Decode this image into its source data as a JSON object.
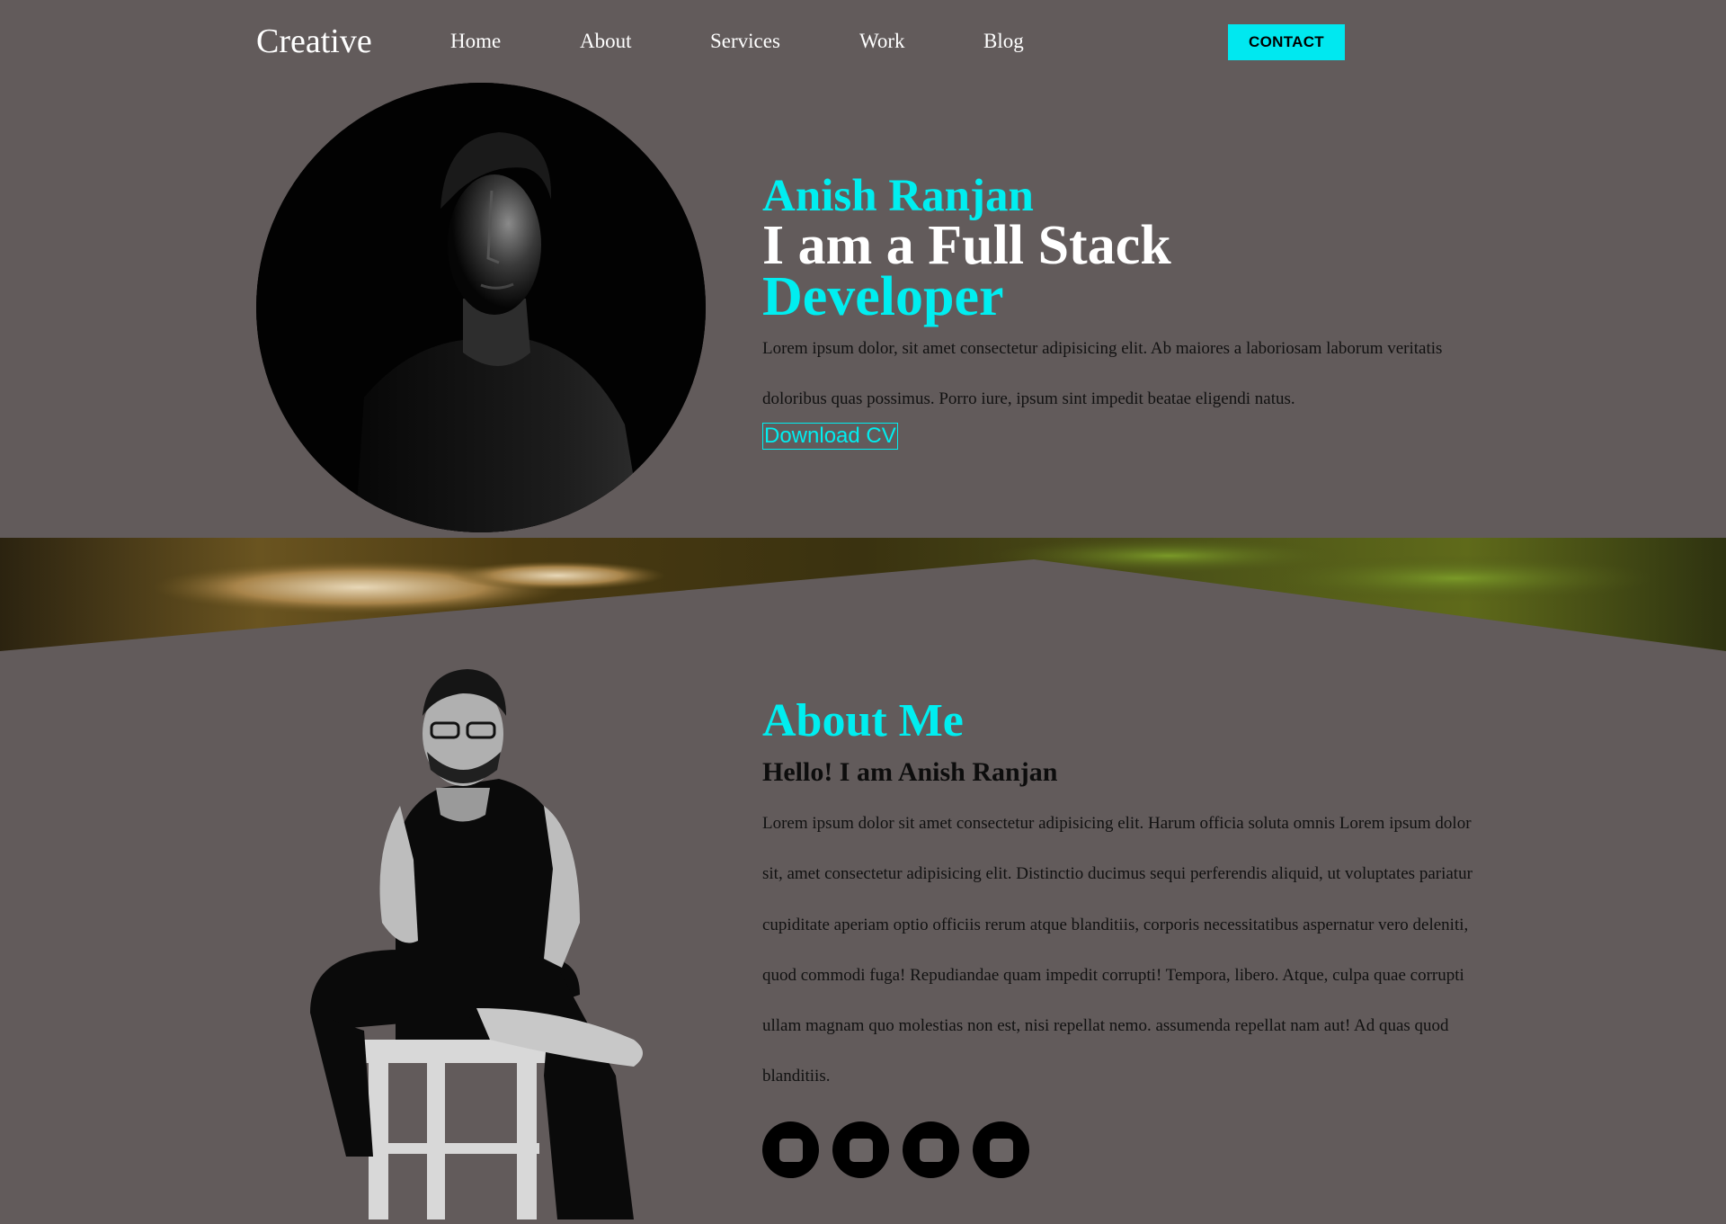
{
  "nav": {
    "logo": "Creative",
    "links": [
      "Home",
      "About",
      "Services",
      "Work",
      "Blog"
    ],
    "contact": "CONTACT"
  },
  "hero": {
    "name": "Anish Ranjan",
    "title_line1": "I am a Full Stack",
    "title_line2": "Developer",
    "description": "Lorem ipsum dolor, sit amet consectetur adipisicing elit. Ab maiores a laboriosam laborum veritatis doloribus quas possimus. Porro iure, ipsum sint impedit beatae eligendi natus.",
    "download_label": "Download CV"
  },
  "about": {
    "heading": "About Me",
    "subheading": "Hello! I am Anish Ranjan",
    "description": "Lorem ipsum dolor sit amet consectetur adipisicing elit. Harum officia soluta omnis Lorem ipsum dolor sit, amet consectetur adipisicing elit. Distinctio ducimus sequi perferendis aliquid, ut voluptates pariatur cupiditate aperiam optio officiis rerum atque blanditiis, corporis necessitatibus aspernatur vero deleniti, quod commodi fuga! Repudiandae quam impedit corrupti! Tempora, libero. Atque, culpa quae corrupti ullam magnam quo molestias non est, nisi repellat nemo. assumenda repellat nam aut! Ad quas quod blanditiis."
  },
  "social_icons": [
    "social-icon-1",
    "social-icon-2",
    "social-icon-3",
    "social-icon-4"
  ],
  "colors": {
    "background": "#625b5b",
    "accent": "#00eef0",
    "contact_button": "#00e8f0",
    "text_dark": "#111111",
    "text_light": "#ffffff"
  }
}
